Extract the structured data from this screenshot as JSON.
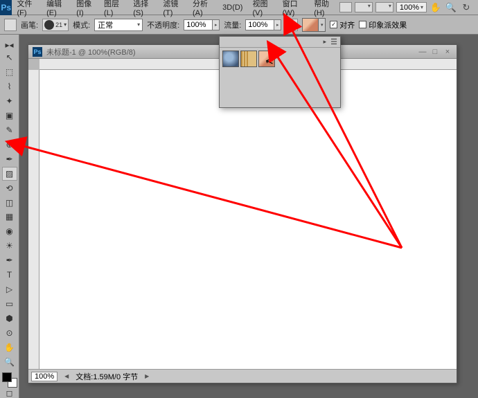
{
  "app_icon": "Ps",
  "menu": [
    "文件(F)",
    "编辑(E)",
    "图像(I)",
    "图层(L)",
    "选择(S)",
    "滤镜(T)",
    "分析(A)",
    "3D(D)",
    "视图(V)",
    "窗口(W)",
    "帮助(H)"
  ],
  "menubar_right": {
    "zoom": "100%"
  },
  "options": {
    "brush_label": "画笔:",
    "brush_size": "21",
    "mode_label": "模式:",
    "mode_value": "正常",
    "opacity_label": "不透明度:",
    "opacity_value": "100%",
    "flow_label": "流量:",
    "flow_value": "100%",
    "align_label": "对齐",
    "align_checked": true,
    "impressionist_label": "印象派效果",
    "impressionist_checked": false
  },
  "tools": [
    "▭",
    "⬚",
    "◫",
    "✂",
    "✎",
    "✓",
    "✒",
    "▨",
    "▤",
    "△",
    "◐",
    "✎",
    "⬛",
    "◉",
    "T",
    "▷",
    "▭",
    "☖",
    "✋",
    "🔍"
  ],
  "selected_tool_index": 8,
  "doc": {
    "title": "未标题-1 @ 100%(RGB/8)",
    "zoom": "100%",
    "status": "文档:1.59M/0 字节"
  },
  "popup_thumbs": 3
}
